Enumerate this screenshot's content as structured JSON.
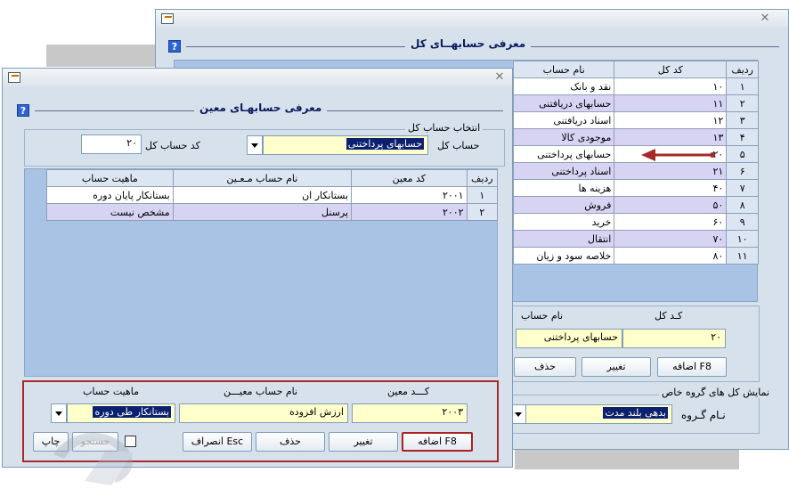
{
  "back_window": {
    "title": "معرفی حسابهــای کل",
    "help": "?",
    "grid": {
      "headers": [
        "ردیف",
        "کد کل",
        "نام حساب"
      ],
      "rows": [
        {
          "idx": "۱",
          "code": "۱۰",
          "name": "نقد و بانک"
        },
        {
          "idx": "۲",
          "code": "۱۱",
          "name": "حسابهای دریافتنی"
        },
        {
          "idx": "۳",
          "code": "۱۲",
          "name": "اسناد دریافتنی"
        },
        {
          "idx": "۴",
          "code": "۱۳",
          "name": "موجودی کالا"
        },
        {
          "idx": "۵",
          "code": "۲۰",
          "name": "حسابهای پرداختنی"
        },
        {
          "idx": "۶",
          "code": "۲۱",
          "name": "اسناد پرداختنی"
        },
        {
          "idx": "۷",
          "code": "۴۰",
          "name": "هزینه ها"
        },
        {
          "idx": "۸",
          "code": "۵۰",
          "name": "فروش"
        },
        {
          "idx": "۹",
          "code": "۶۰",
          "name": "خرید"
        },
        {
          "idx": "۱۰",
          "code": "۷۰",
          "name": "انتقال"
        },
        {
          "idx": "۱۱",
          "code": "۸۰",
          "name": "خلاصه سود و زیان"
        }
      ]
    },
    "form": {
      "code_label": "کـد کل",
      "name_label": "نام حساب",
      "code_value": "۲۰",
      "name_value": "حسابهای پرداختنی"
    },
    "buttons": {
      "add": "اضافه F8",
      "edit": "تغییر",
      "delete": "حذف"
    },
    "group_section": {
      "title": "نمایش کل های گروه خاص",
      "label": "نـام گـروه",
      "value": "بدهی بلند مدت"
    }
  },
  "front_window": {
    "title": "معرفی حسابهـای معین",
    "help": "?",
    "selector": {
      "section_title": "انتخاب حساب کل",
      "account_label": "حساب کل",
      "account_value": "حسابهای پرداختنی",
      "code_label": "کد حساب کل",
      "code_value": "۲۰"
    },
    "grid": {
      "headers": [
        "ردیف",
        "کد معین",
        "نام حساب مـعـین",
        "ماهیت حساب"
      ],
      "rows": [
        {
          "idx": "۱",
          "code": "۲۰۰۱",
          "name": "بستانکار ان",
          "nature": "بستانکار پایان دوره"
        },
        {
          "idx": "۲",
          "code": "۲۰۰۲",
          "name": "پرسنل",
          "nature": "مشخص نیست"
        }
      ]
    },
    "form": {
      "code_label": "کـــد معین",
      "name_label": "نام حساب معیـــن",
      "nature_label": "ماهیت حساب",
      "code_value": "۲۰۰۳",
      "name_value": "ارزش افزوده",
      "nature_value": "بستانکار طی دوره"
    },
    "buttons": {
      "add": "اضافه F8",
      "edit": "تغییر",
      "delete": "حذف",
      "cancel": "انصراف Esc",
      "search": "جستجو",
      "print": "چاپ"
    }
  },
  "colors": {
    "accent_red": "#a52a2a",
    "selected_bg": "#0b2170",
    "field_bg": "#ffffcc"
  }
}
